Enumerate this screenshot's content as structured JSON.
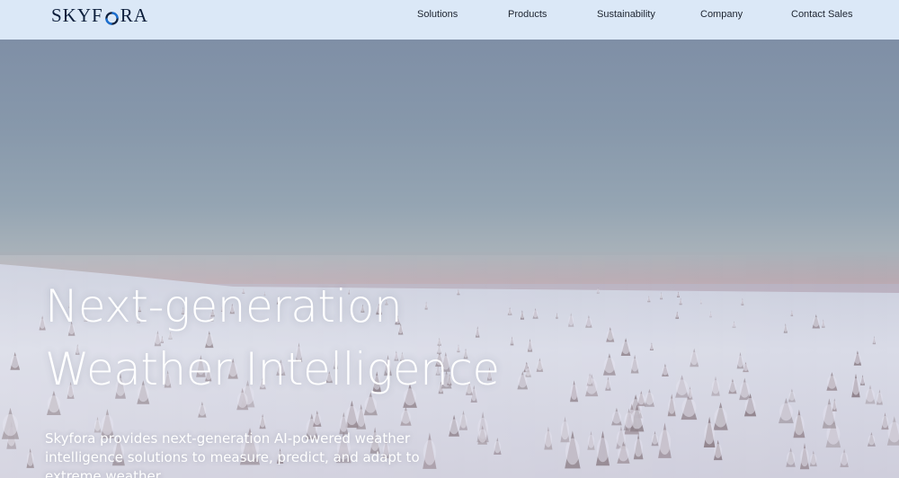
{
  "brand": {
    "name_part1": "SKYF",
    "name_part2": "RA",
    "logo_icon": "swirl-o-icon",
    "logo_color": "#0d1f3c",
    "accent_color": "#1a6fd1"
  },
  "nav": {
    "items": [
      {
        "label": "Solutions"
      },
      {
        "label": "Products"
      },
      {
        "label": "Sustainability"
      },
      {
        "label": "Company"
      },
      {
        "label": "Contact Sales"
      }
    ]
  },
  "hero": {
    "title_line1": "Next-generation",
    "title_line2": "Weather Intelligence",
    "description": "Skyfora provides next-generation AI-powered weather intelligence solutions to measure, predict, and adapt to extreme weather."
  }
}
